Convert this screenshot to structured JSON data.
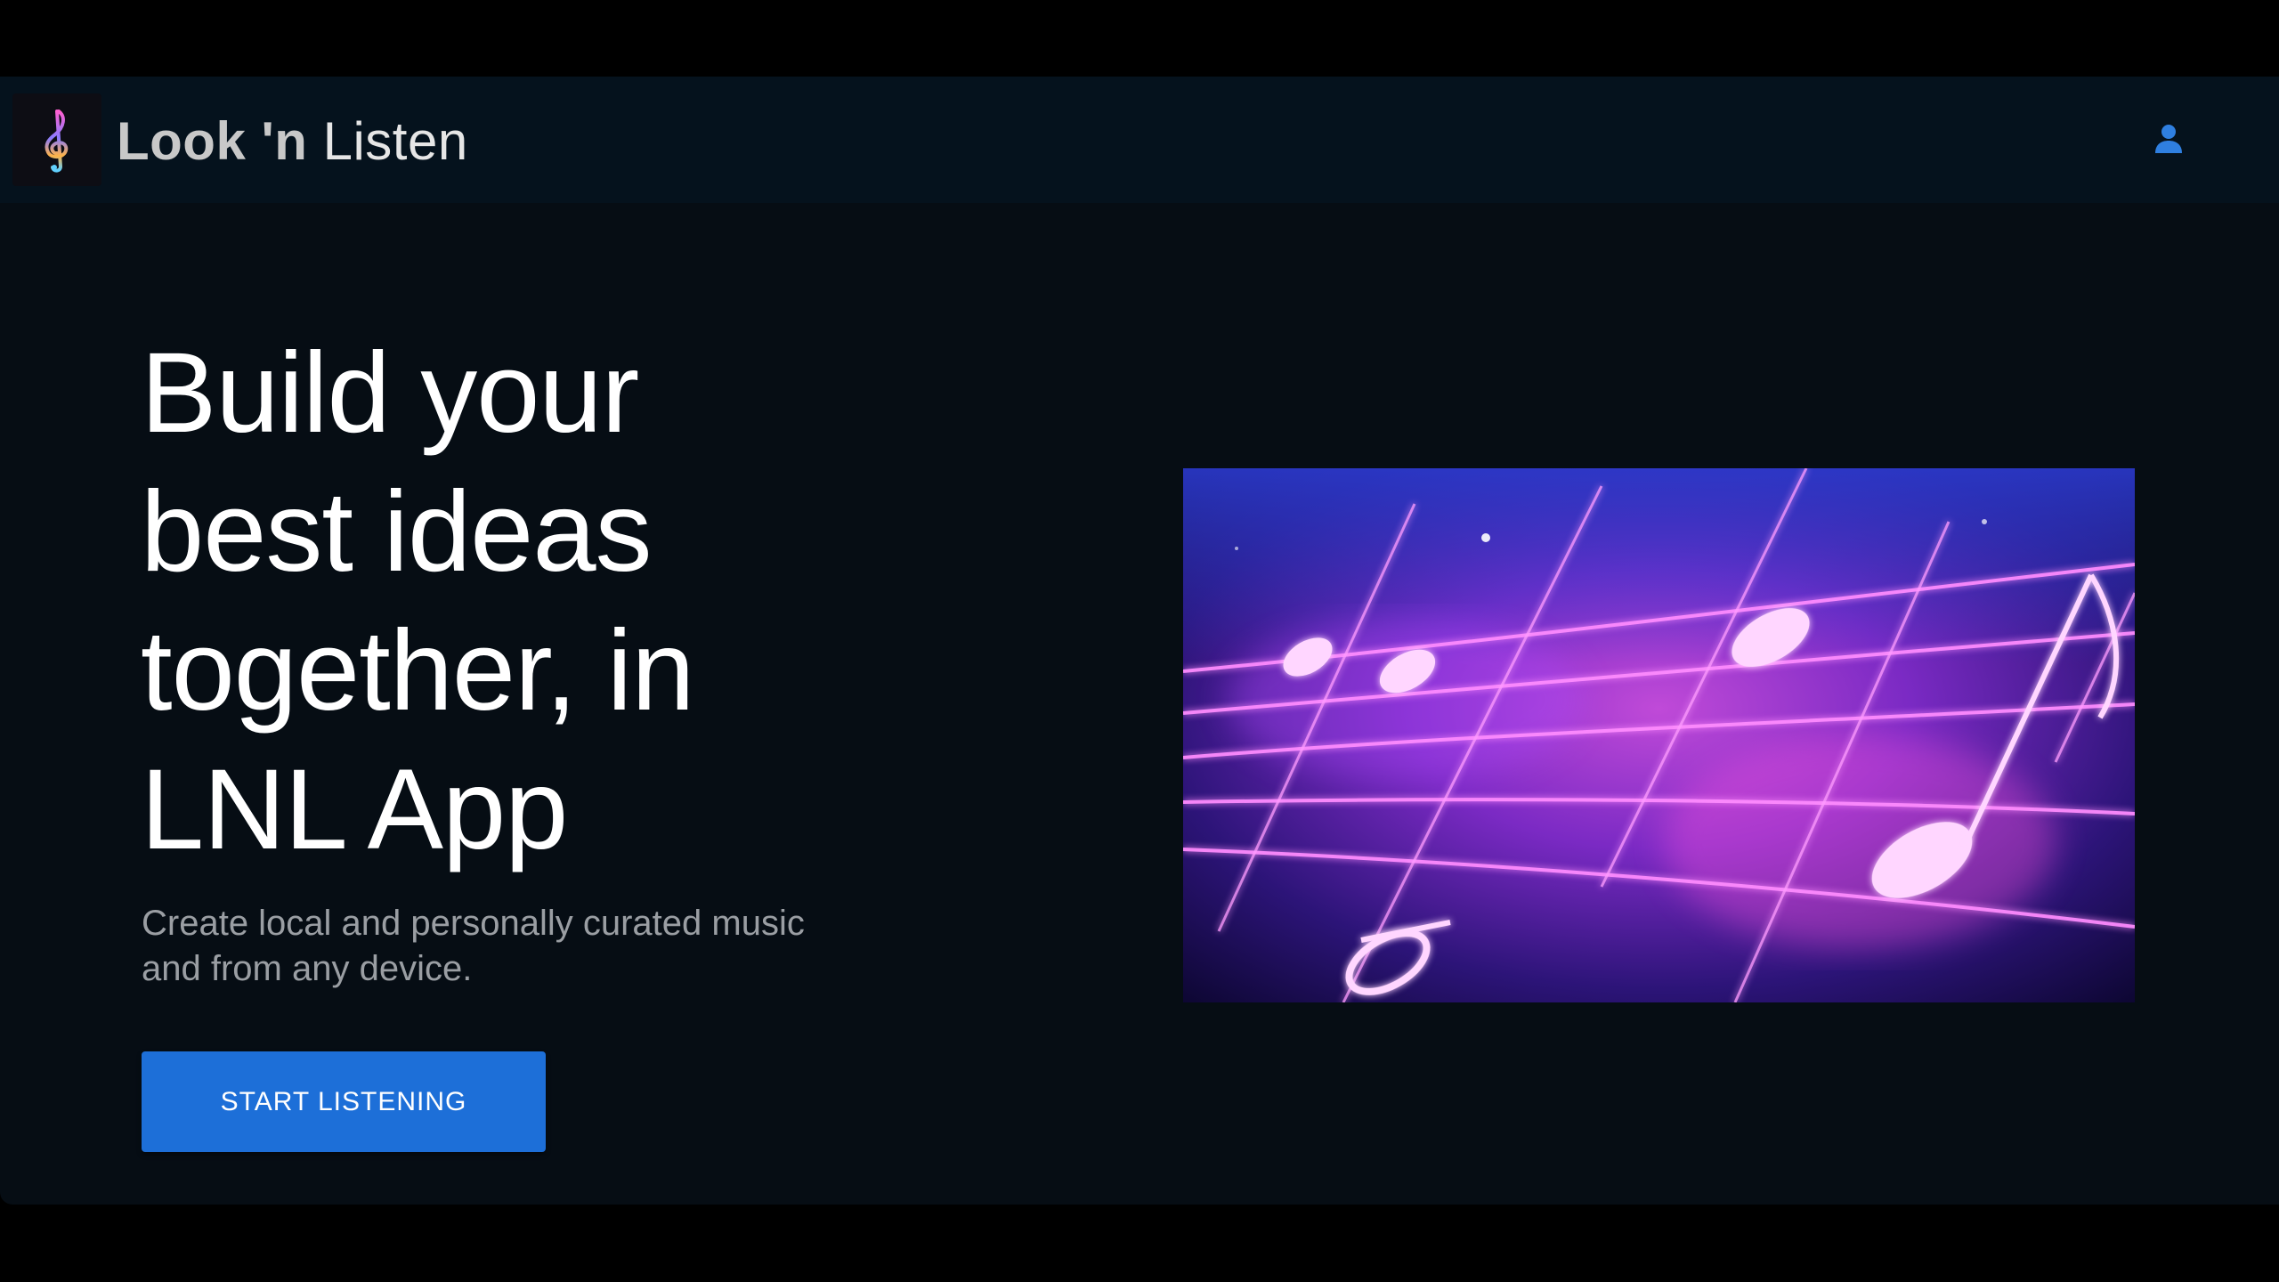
{
  "navbar": {
    "brand_bold": "Look 'n",
    "brand_regular": "Listen",
    "logo_icon": "treble-clef-icon",
    "user_icon": "user-icon"
  },
  "hero": {
    "title_lines": [
      "Build your",
      "best ideas",
      "together, in",
      "LNL App"
    ],
    "subtitle_lines": [
      "Create local and personally curated music",
      "and from any device."
    ],
    "cta_label": "START LISTENING",
    "image_subject": "neon-music-notes-staff"
  },
  "colors": {
    "page_background": "#060d14",
    "navbar_background": "#05121d",
    "accent": "#1d6fd8",
    "title_text": "#ffffff",
    "subtitle_text": "#9a9ea3",
    "user_icon": "#2f7fe0",
    "neon_magenta": "#ff40ff",
    "neon_violet": "#7a2fd8"
  }
}
